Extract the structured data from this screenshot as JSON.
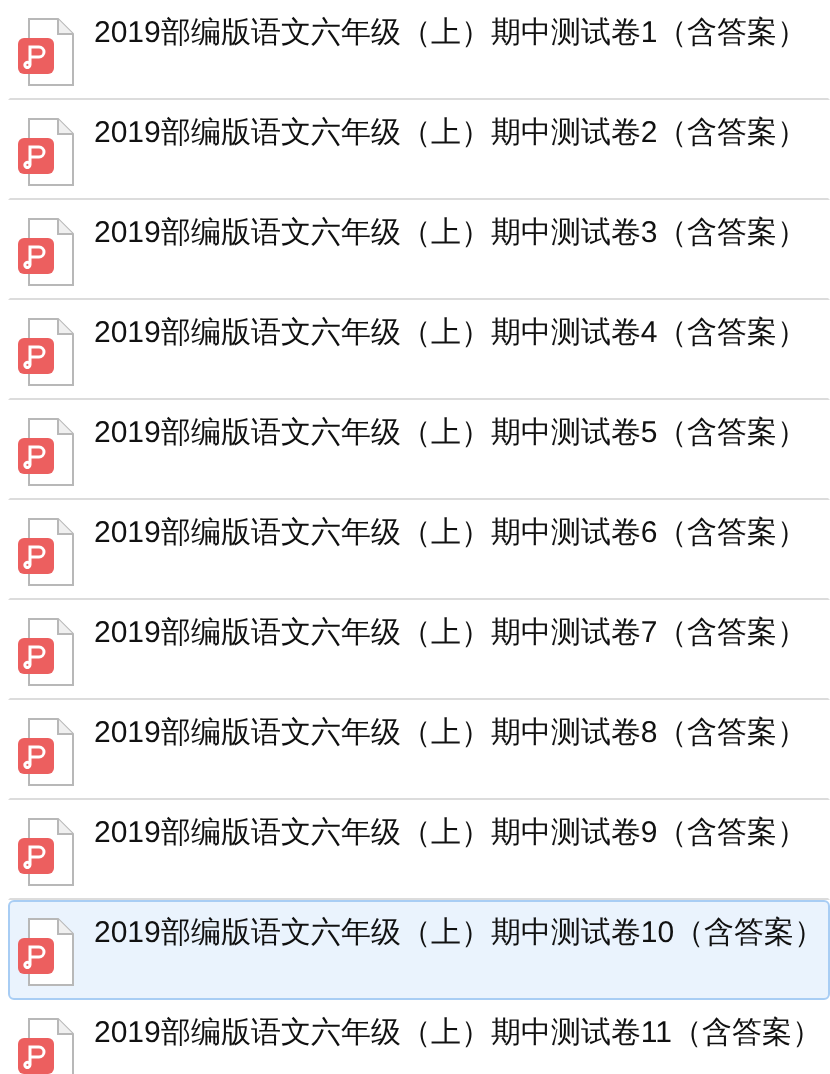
{
  "files": [
    {
      "name": "2019部编版语文六年级（上）期中测试卷1（含答案）",
      "selected": false
    },
    {
      "name": "2019部编版语文六年级（上）期中测试卷2（含答案）",
      "selected": false
    },
    {
      "name": "2019部编版语文六年级（上）期中测试卷3（含答案）",
      "selected": false
    },
    {
      "name": "2019部编版语文六年级（上）期中测试卷4（含答案）",
      "selected": false
    },
    {
      "name": "2019部编版语文六年级（上）期中测试卷5（含答案）",
      "selected": false
    },
    {
      "name": "2019部编版语文六年级（上）期中测试卷6（含答案）",
      "selected": false
    },
    {
      "name": "2019部编版语文六年级（上）期中测试卷7（含答案）",
      "selected": false
    },
    {
      "name": "2019部编版语文六年级（上）期中测试卷8（含答案）",
      "selected": false
    },
    {
      "name": "2019部编版语文六年级（上）期中测试卷9（含答案）",
      "selected": false
    },
    {
      "name": "2019部编版语文六年级（上）期中测试卷10（含答案）",
      "selected": true
    },
    {
      "name": "2019部编版语文六年级（上）期中测试卷11（含答案）",
      "selected": false
    }
  ]
}
